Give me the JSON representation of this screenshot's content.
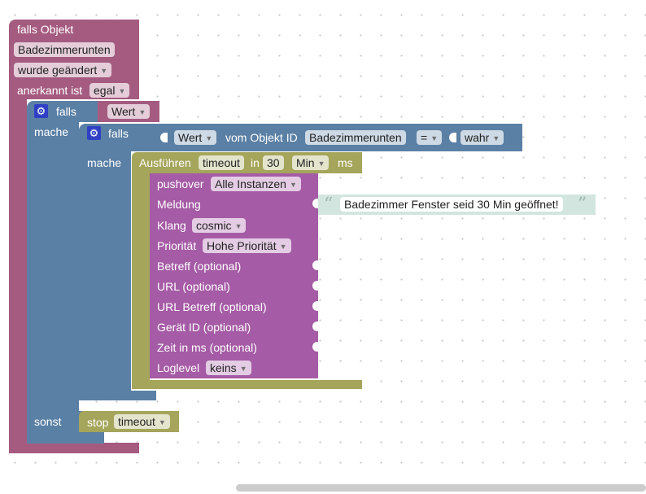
{
  "trigger_block": {
    "title": "falls Objekt",
    "object_id": "Badezimmerunten",
    "change_label": "wurde geändert",
    "ack_label": "anerkannt ist",
    "ack_value": "egal"
  },
  "outer_if": {
    "if_label": "falls",
    "do_label": "mache",
    "else_label": "sonst",
    "condition_value": "Wert"
  },
  "inner_if": {
    "if_label": "falls",
    "do_label": "mache",
    "value_dropdown": "Wert",
    "from_object_label": "vom Objekt ID",
    "object_id": "Badezimmerunten",
    "operator": "=",
    "compare_value": "wahr"
  },
  "timeout_block": {
    "label": "Ausführen",
    "name": "timeout",
    "in_label": "in",
    "duration": "30",
    "unit": "Min",
    "ms_label": "ms"
  },
  "pushover": {
    "label": "pushover",
    "instance": "Alle Instanzen",
    "message_label": "Meldung",
    "message_text": "Badezimmer Fenster seid 30 Min geöffnet!",
    "sound_label": "Klang",
    "sound": "cosmic",
    "priority_label": "Priorität",
    "priority": "Hohe Priorität",
    "subject_label": "Betreff (optional)",
    "url_label": "URL (optional)",
    "url_subject_label": "URL Betreff (optional)",
    "device_label": "Gerät ID (optional)",
    "time_label": "Zeit in ms (optional)",
    "loglevel_label": "Loglevel",
    "loglevel": "keins"
  },
  "stop_block": {
    "label": "stop",
    "name": "timeout"
  },
  "colors": {
    "trigger": "#a55b80",
    "logic": "#5b80a5",
    "pushover": "#a55ba5",
    "timeout": "#a5a55b",
    "string": "#d2e6df"
  },
  "icons": {
    "dropdown": "▼",
    "gear": "⚙",
    "quote_open": "“",
    "quote_close": "”"
  }
}
